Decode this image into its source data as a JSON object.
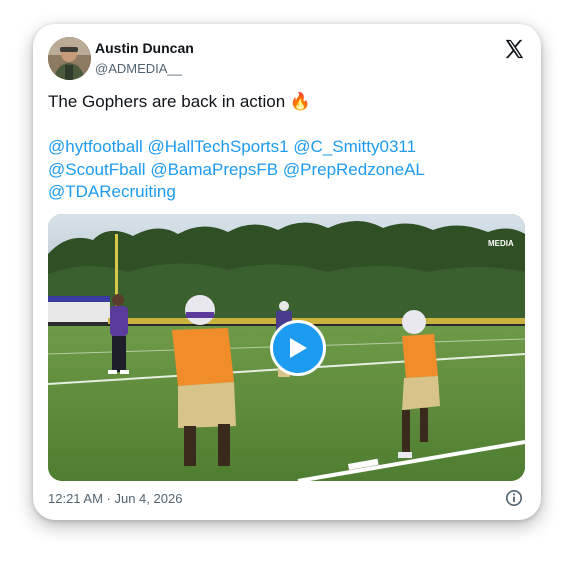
{
  "author": {
    "name": "Austin Duncan",
    "handle": "@ADMEDIA__"
  },
  "tweet": {
    "text": "The Gophers are back in action",
    "emoji": "🔥",
    "mentions": [
      "@hytfootball",
      "@HallTechSports1",
      "@C_Smitty0311",
      "@ScoutFball",
      "@BamaPrepsFB",
      "@PrepRedzoneAL",
      "@TDARecruiting"
    ]
  },
  "media": {
    "watermark": "MEDIA"
  },
  "footer": {
    "timestamp": "12:21 AM · Jun 4, 2026"
  },
  "icons": {
    "logo": "x-logo-icon",
    "play": "play-icon",
    "info": "info-icon"
  },
  "colors": {
    "link": "#1d9bf0",
    "text": "#0f1419",
    "muted": "#536471"
  }
}
